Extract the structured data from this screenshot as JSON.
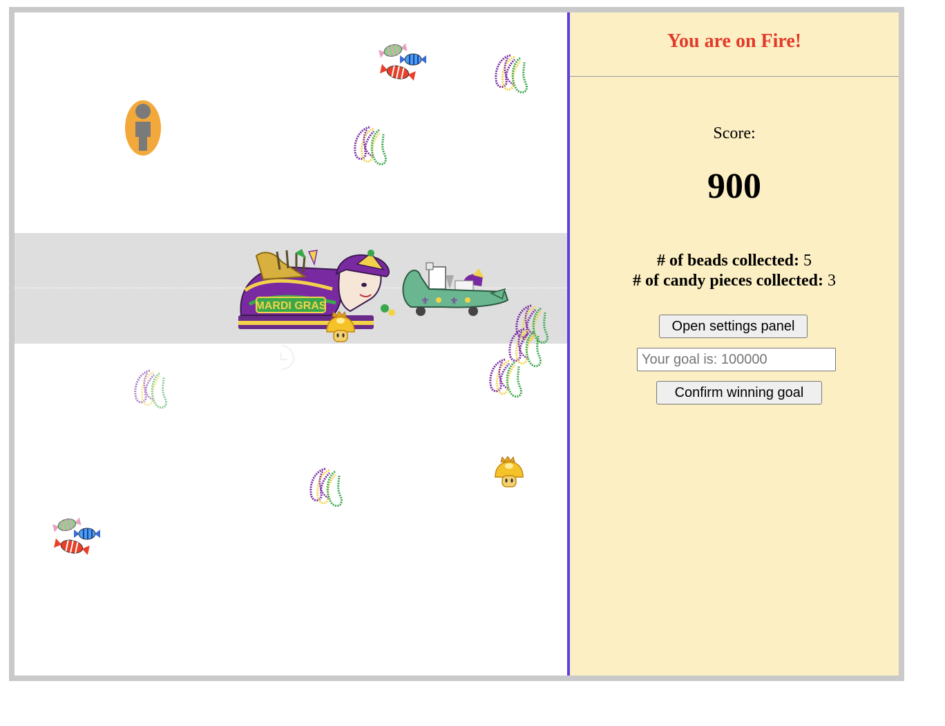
{
  "sidebar": {
    "status_message": "You are on Fire!",
    "score_label": "Score:",
    "score_value": "900",
    "beads_label": "# of beads collected:",
    "beads_count": "5",
    "candy_label": "# of candy pieces collected:",
    "candy_count": "3",
    "settings_button": "Open settings panel",
    "goal_placeholder": "Your goal is: 100000",
    "goal_value": "",
    "confirm_button": "Confirm winning goal"
  },
  "float_banner_text": "MARDI GRAS",
  "colors": {
    "status_text": "#e23a2a",
    "divider": "#5b3fe0",
    "sidebar_bg": "#fcefc3",
    "road": "#dedede",
    "frame": "#c9c9c9",
    "player": "#f2a83a",
    "bead_purple": "#7a2aa0",
    "bead_gold": "#f2d24a",
    "bead_green": "#3aa84a",
    "gator_float": "#6ab690"
  },
  "icons": {
    "player": "person-icon",
    "beads": "beads-icon",
    "candy": "candy-icon",
    "powerup": "golden-mushroom-icon",
    "parade_float": "mardi-gras-float-icon",
    "gator_float": "alligator-float-icon"
  }
}
